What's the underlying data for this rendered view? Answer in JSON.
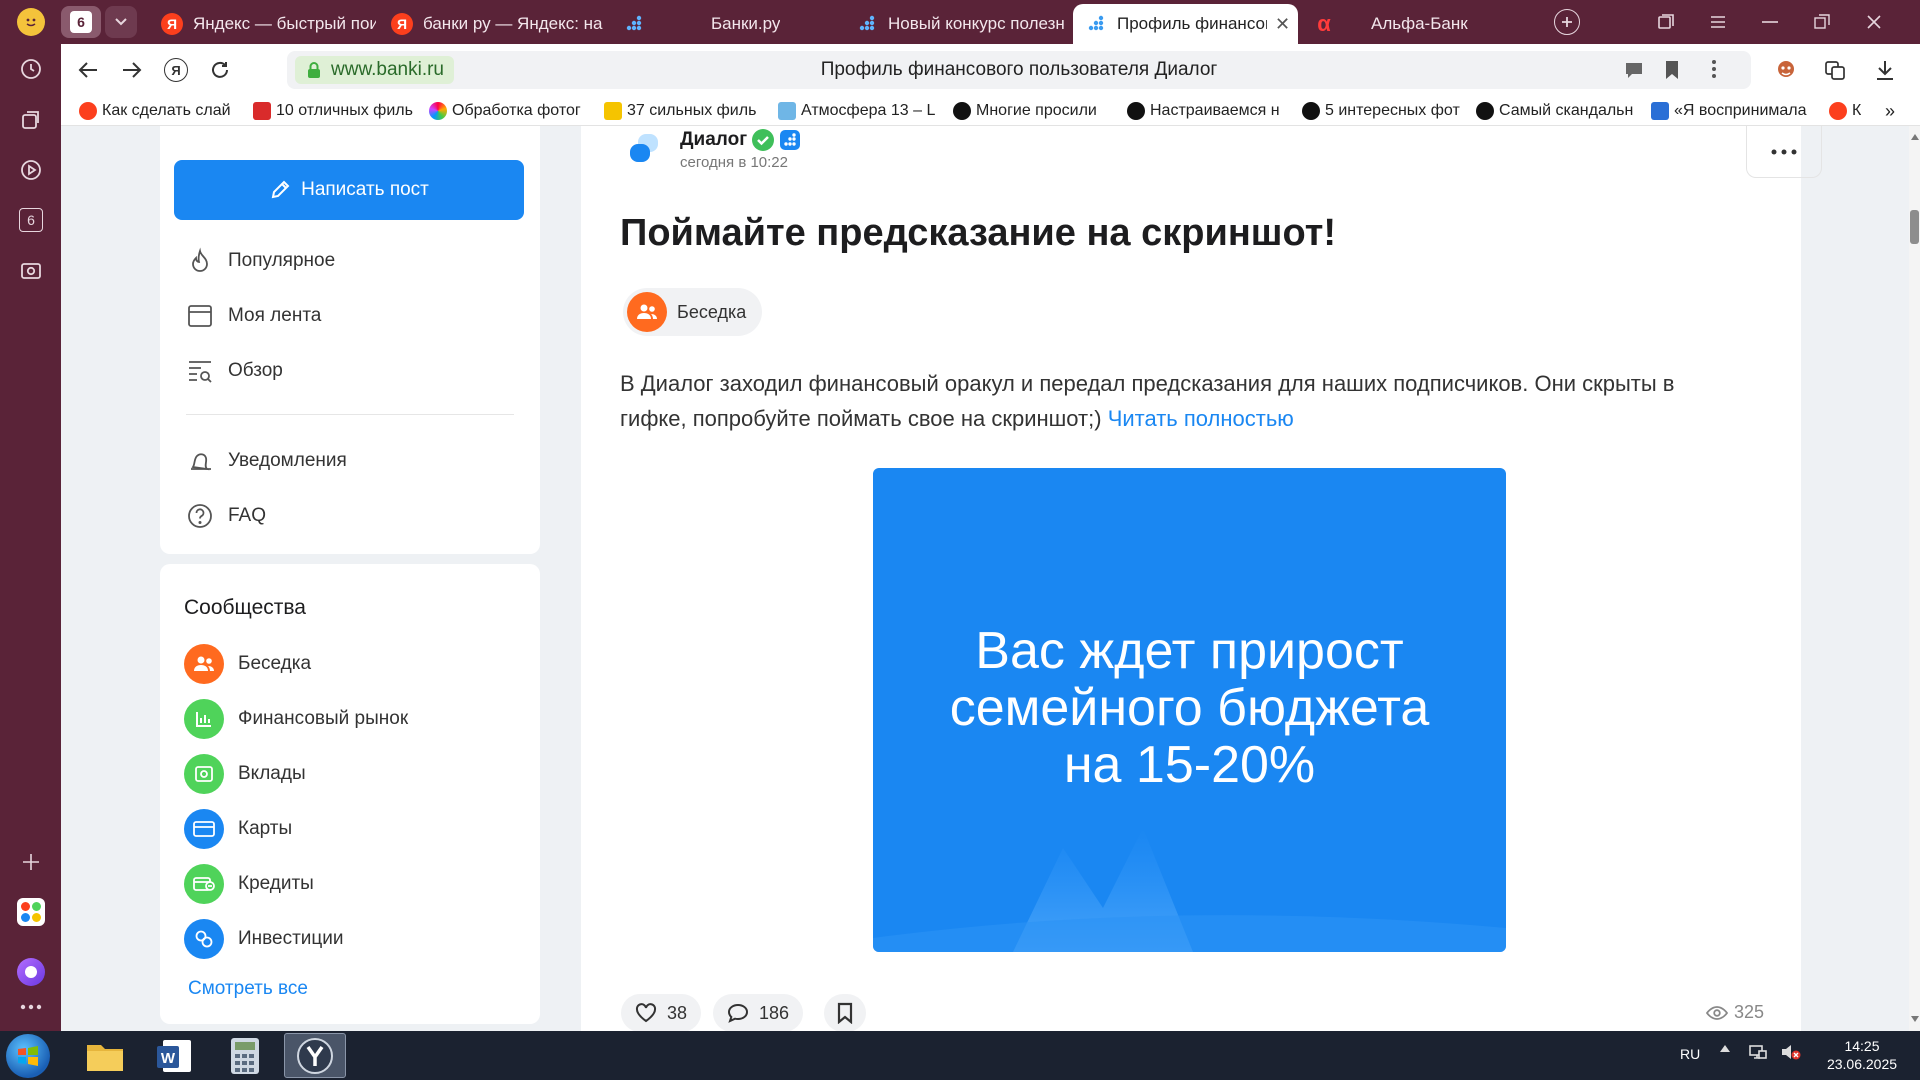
{
  "colors": {
    "browser_chrome": "#5a2338",
    "accent_blue": "#1a87f2",
    "lock_green": "#3fae3f",
    "page_bg": "#eef1f4"
  },
  "browser": {
    "tab_counter": "6",
    "tabs": [
      {
        "title": "Яндекс — быстрый пои",
        "icon": "yandex-icon"
      },
      {
        "title": "банки ру — Яндекс: на",
        "icon": "yandex-icon"
      },
      {
        "title": "",
        "icon": "banki-icon"
      },
      {
        "title": "Банки.ру",
        "icon": "banki-icon"
      },
      {
        "title": "Новый конкурс полезн",
        "icon": "banki-icon"
      },
      {
        "title": "Профиль финансово",
        "icon": "banki-icon",
        "active": true
      },
      {
        "title": "Альфа-Банк",
        "icon": "alfa-icon"
      }
    ],
    "address": {
      "domain": "www.banki.ru",
      "page_title": "Профиль финансового пользователя Диалог"
    },
    "bookmarks": [
      {
        "label": "Как сделать слай",
        "icon_color": "#fc3f1d"
      },
      {
        "label": "10 отличных филь",
        "icon_color": "#d92b2b"
      },
      {
        "label": "Обработка фотог",
        "icon_color": "#c46ad6"
      },
      {
        "label": "37 сильных филь",
        "icon_color": "#f5c400"
      },
      {
        "label": "Атмосфера 13 – L",
        "icon_color": "#6fb6e6"
      },
      {
        "label": "Многие просили",
        "icon_color": "#111111"
      },
      {
        "label": "Настраиваемся н",
        "icon_color": "#111111"
      },
      {
        "label": "5 интересных фот",
        "icon_color": "#111111"
      },
      {
        "label": "Самый скандальн",
        "icon_color": "#111111"
      },
      {
        "label": "«Я воспринимала",
        "icon_color": "#2a6fd6"
      },
      {
        "label": "К",
        "icon_color": "#fc3f1d"
      }
    ]
  },
  "sidebar": {
    "write_post_label": "Написать пост",
    "menu": [
      {
        "label": "Популярное",
        "icon": "fire-icon"
      },
      {
        "label": "Моя лента",
        "icon": "feed-icon"
      },
      {
        "label": "Обзор",
        "icon": "overview-icon"
      },
      {
        "label": "Уведомления",
        "icon": "bell-icon"
      },
      {
        "label": "FAQ",
        "icon": "question-icon"
      }
    ],
    "communities_title": "Сообщества",
    "communities": [
      {
        "label": "Беседка",
        "icon": "people-icon",
        "color": "#ff6a1f"
      },
      {
        "label": "Финансовый рынок",
        "icon": "chart-icon",
        "color": "#4fd35a"
      },
      {
        "label": "Вклады",
        "icon": "safe-icon",
        "color": "#4fd35a"
      },
      {
        "label": "Карты",
        "icon": "card-icon",
        "color": "#1a87f2"
      },
      {
        "label": "Кредиты",
        "icon": "credit-icon",
        "color": "#4fd35a"
      },
      {
        "label": "Инвестиции",
        "icon": "invest-icon",
        "color": "#1a87f2"
      }
    ],
    "see_all": "Смотреть все"
  },
  "post": {
    "author": "Диалог",
    "time": "сегодня в 10:22",
    "title": "Поймайте предсказание на скриншот!",
    "community_tag": "Беседка",
    "body": "В Диалог заходил финансовый оракул и передал предсказания для наших подписчиков. Они скрыты в гифке, попробуйте поймать свое на скриншот;)",
    "read_more": "Читать полностью",
    "image_lines": [
      "Вас ждет прирост",
      "семейного бюджета",
      "на 15-20%"
    ],
    "likes": "38",
    "comments": "186",
    "views": "325"
  },
  "taskbar": {
    "language": "RU",
    "time": "14:25",
    "date": "23.06.2025"
  }
}
